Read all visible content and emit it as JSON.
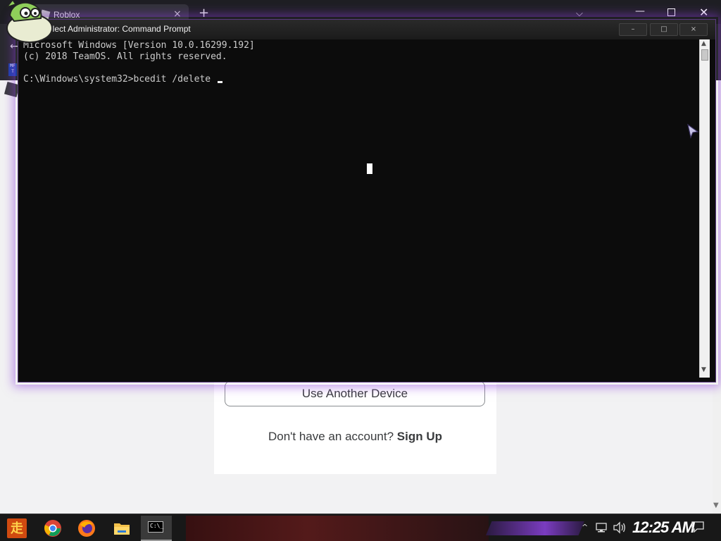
{
  "browser": {
    "tab_title": "Roblox",
    "tab_close": "×",
    "new_tab": "+",
    "tab_dropdown": "⌵",
    "win_min": "—",
    "win_close": "✕",
    "back": "←",
    "bookmark_text": "MF T"
  },
  "login": {
    "another_device_label": "Use Another Device",
    "signup_prompt": "Don't have an account?",
    "signup_link": "Sign Up"
  },
  "cmd": {
    "title": "Select Administrator: Command Prompt",
    "min": "–",
    "max": "□",
    "close": "×",
    "lines": [
      "Microsoft Windows [Version 10.0.16299.192]",
      "(c) 2018 TeamOS. All rights reserved.",
      "",
      "C:\\Windows\\system32>bcedit /delete "
    ],
    "scroll_up": "▲",
    "scroll_down": "▼"
  },
  "taskbar": {
    "start_glyph": "走",
    "cmd_icon_text": "C:\\_",
    "tray_chevron": "^",
    "clock": "12:25 AM"
  },
  "colors": {
    "console_bg": "#0c0c0c",
    "console_text": "#cccccc",
    "window_glow": "#8c3cdc",
    "taskbar_bg": "#181818"
  }
}
